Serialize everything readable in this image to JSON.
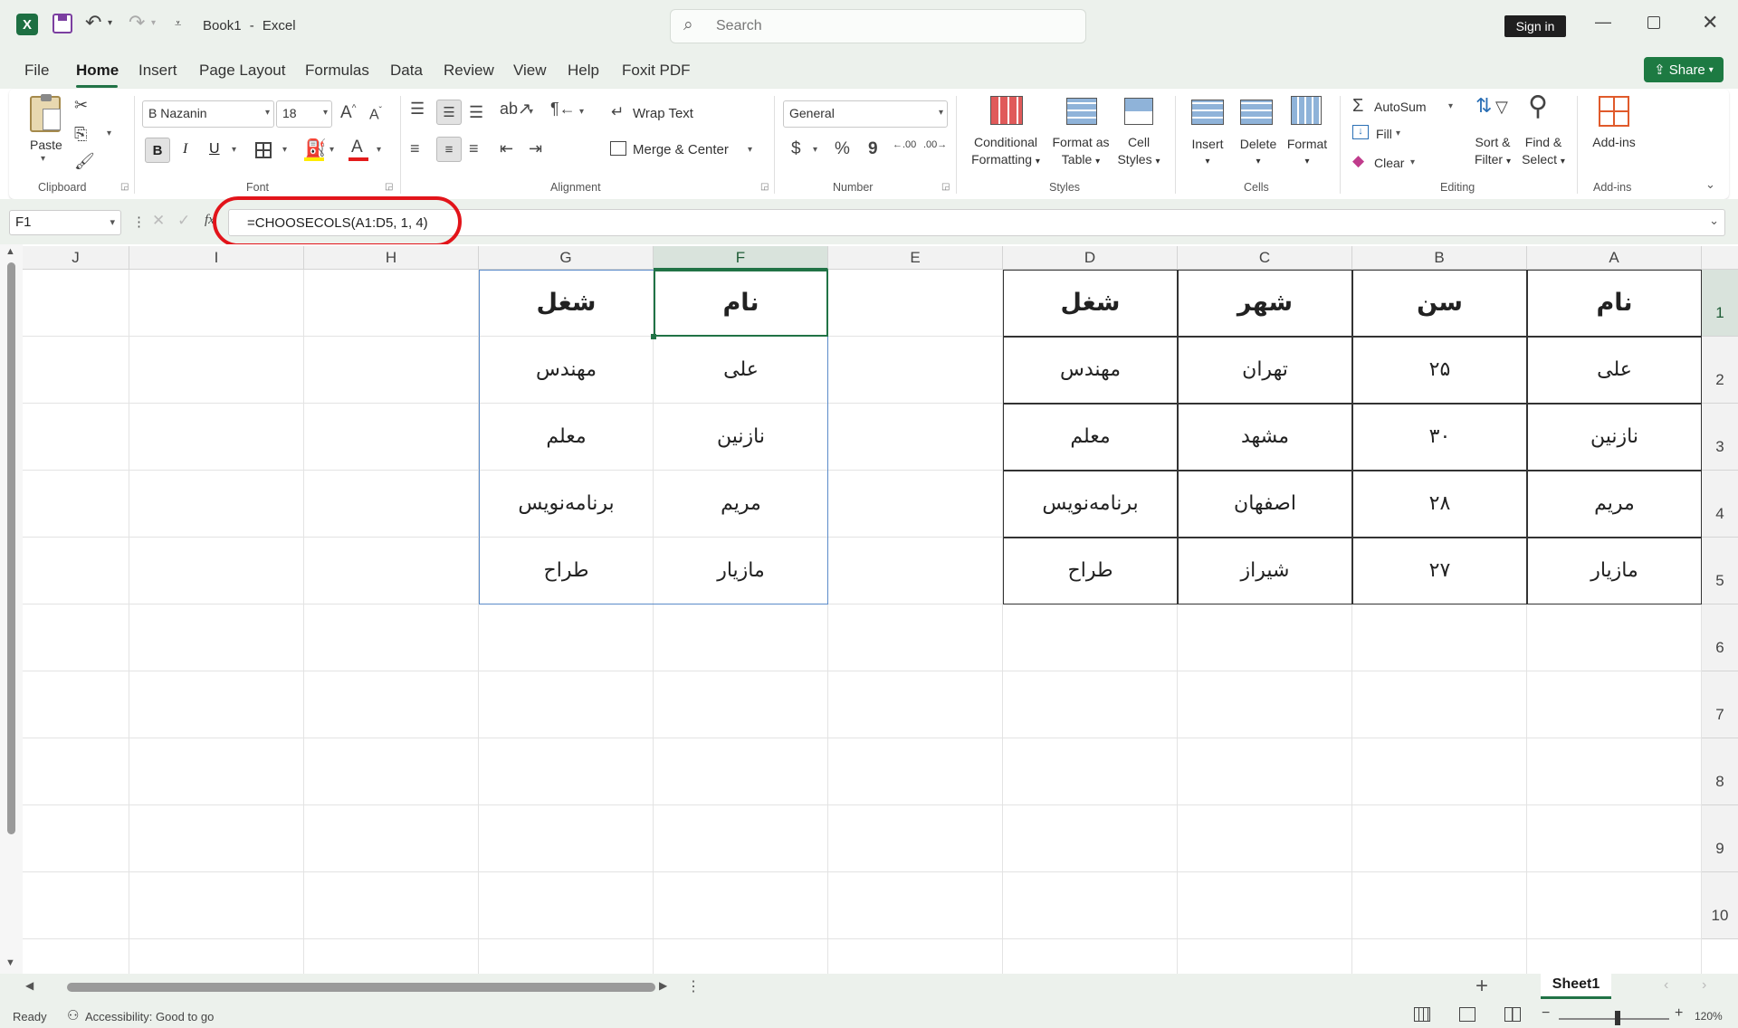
{
  "titlebar": {
    "doc_name": "Book1",
    "separator": "-",
    "app_name": "Excel",
    "search_placeholder": "Search",
    "sign_in": "Sign in"
  },
  "tabs": [
    "File",
    "Home",
    "Insert",
    "Page Layout",
    "Formulas",
    "Data",
    "Review",
    "View",
    "Help",
    "Foxit PDF"
  ],
  "share_label": "Share",
  "ribbon": {
    "clipboard": {
      "paste": "Paste",
      "group": "Clipboard"
    },
    "font": {
      "family": "B Nazanin",
      "size": "18",
      "group": "Font",
      "bold": "B",
      "italic": "I",
      "underline": "U"
    },
    "alignment": {
      "wrap": "Wrap Text",
      "merge": "Merge & Center",
      "group": "Alignment"
    },
    "number": {
      "format": "General",
      "dollar": "$",
      "percent": "%",
      "comma": "9",
      "inc": ".00",
      "dec": ".00",
      "group": "Number"
    },
    "styles": {
      "conditional1": "Conditional",
      "conditional2": "Formatting",
      "table1": "Format as",
      "table2": "Table",
      "cell1": "Cell",
      "cell2": "Styles",
      "group": "Styles"
    },
    "cells": {
      "insert": "Insert",
      "delete": "Delete",
      "format": "Format",
      "group": "Cells"
    },
    "editing": {
      "autosum": "AutoSum",
      "fill": "Fill",
      "clear": "Clear",
      "sort1": "Sort &",
      "sort2": "Filter",
      "find1": "Find &",
      "find2": "Select",
      "group": "Editing"
    },
    "addins": {
      "label": "Add-ins",
      "group": "Add-ins"
    }
  },
  "formula_bar": {
    "name_box": "F1",
    "fx": "fx",
    "formula": "=CHOOSECOLS(A1:D5, 1, 4)"
  },
  "sheet": {
    "columns": [
      "A",
      "B",
      "C",
      "D",
      "E",
      "F",
      "G",
      "H",
      "I",
      "J"
    ],
    "rows": [
      "1",
      "2",
      "3",
      "4",
      "5",
      "6",
      "7",
      "8",
      "9",
      "10"
    ],
    "selected_cell": "F1",
    "source_table": [
      [
        "نام",
        "سن",
        "شهر",
        "شغل"
      ],
      [
        "علی",
        "۲۵",
        "تهران",
        "مهندس"
      ],
      [
        "نازنین",
        "۳۰",
        "مشهد",
        "معلم"
      ],
      [
        "مریم",
        "۲۸",
        "اصفهان",
        "برنامه‌نویس"
      ],
      [
        "مازیار",
        "۲۷",
        "شیراز",
        "طراح"
      ]
    ],
    "result_table": [
      [
        "نام",
        "شغل"
      ],
      [
        "علی",
        "مهندس"
      ],
      [
        "نازنین",
        "معلم"
      ],
      [
        "مریم",
        "برنامه‌نویس"
      ],
      [
        "مازیار",
        "طراح"
      ]
    ]
  },
  "sheet_tab": "Sheet1",
  "status": {
    "ready": "Ready",
    "accessibility": "Accessibility: Good to go",
    "zoom": "120%"
  },
  "colors": {
    "accent": "#217346",
    "highlight_oval": "#e2141a"
  }
}
